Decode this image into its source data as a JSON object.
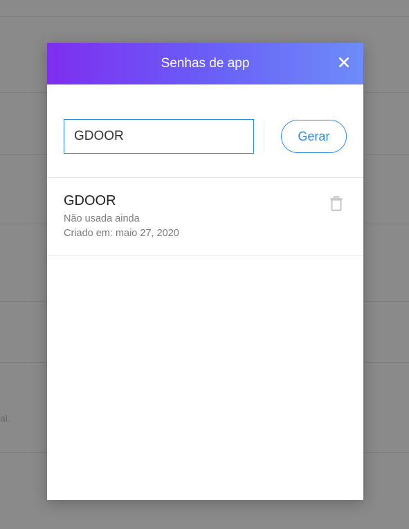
{
  "modal": {
    "title": "Senhas de app",
    "input_value": "GDOOR",
    "generate_label": "Gerar"
  },
  "items": [
    {
      "name": "GDOOR",
      "status": "Não usada ainda",
      "created": "Criado em: maio 27, 2020"
    }
  ],
  "background": {
    "partial_text": "al."
  }
}
